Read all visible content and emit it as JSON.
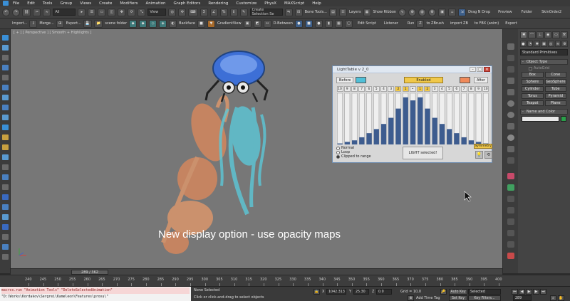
{
  "menu": [
    "File",
    "Edit",
    "Tools",
    "Group",
    "Views",
    "Create",
    "Modifiers",
    "Animation",
    "Graph Editors",
    "Rendering",
    "Customize",
    "PhysX",
    "MAXScript",
    "Help"
  ],
  "toolbar1": {
    "selection_filter": "All",
    "view_dropdown": "View",
    "create_selection_set": "Create Selection Se",
    "bone_tools": "Bone Tools...",
    "layers": "Layers",
    "show_ribbon": "Show Ribbon",
    "drag_n_drop": "Drag N Drop",
    "preview": "Preview",
    "folder": "Folder",
    "skinorder": "SkinOrder2"
  },
  "toolbar2": {
    "import": "Import...",
    "merge": "Merge...",
    "export": "Export",
    "scene_folder": "scene folder",
    "backface": "Backface",
    "gradient_view": "GradientView",
    "d_between": "D-Between",
    "edit_script": "Edit Script",
    "listener": "Listener",
    "run": "Run",
    "to_zbrush": "to ZBrush",
    "import_zb": "import ZB",
    "to_fbx": "to FBX (anim)",
    "export_extra": "Export..."
  },
  "viewport": {
    "label": "[ + ] [ Perspective ] [ Smooth + Highlights ]",
    "caption": "New display option - use opacity maps"
  },
  "lighttable": {
    "title": "LightTable v 2_0",
    "before_label": "Before",
    "after_label": "After",
    "enabled_label": "Enabled",
    "before_color": "#4fc0d8",
    "after_color": "#f08a5a",
    "numbers": [
      "10",
      "9",
      "8",
      "7",
      "6",
      "5",
      "4",
      "3",
      "2",
      "1",
      "•",
      "1",
      "2",
      "3",
      "4",
      "5",
      "6",
      "7",
      "8",
      "9",
      "10"
    ],
    "highlight_index": [
      8,
      9,
      11,
      12
    ],
    "bar_values": [
      0.02,
      0.05,
      0.08,
      0.14,
      0.22,
      0.3,
      0.4,
      0.52,
      0.7,
      0.92,
      0.86,
      0.92,
      0.7,
      0.52,
      0.4,
      0.3,
      0.22,
      0.14,
      0.08,
      0.05,
      0.02
    ],
    "options": [
      "Normal",
      "Loop",
      "Clipped to range"
    ],
    "selected_option": 2,
    "light_selected": "LIGHT selected!",
    "symmetry": "Symmetry",
    "fill_color": "#3d5c8f"
  },
  "cmdpanel": {
    "dropdown": "Standard Primitives",
    "object_type": "Object Type",
    "autogrid": "AutoGrid",
    "objects": [
      "Box",
      "Cone",
      "Sphere",
      "GeoSphere",
      "Cylinder",
      "Tube",
      "Torus",
      "Pyramid",
      "Teapot",
      "Plane"
    ],
    "name_and_color": "Name and Color",
    "name_color": "#2aa04a"
  },
  "timeline": {
    "frame_display": "289 / 362",
    "ticks": [
      "240",
      "245",
      "250",
      "255",
      "260",
      "265",
      "270",
      "275",
      "280",
      "285",
      "290",
      "295",
      "300",
      "305",
      "310",
      "315",
      "320",
      "325",
      "330",
      "335",
      "340",
      "345",
      "350",
      "355",
      "360",
      "365",
      "370",
      "375",
      "380",
      "385",
      "390",
      "395",
      "400"
    ]
  },
  "status": {
    "maxscript_line1": "macros.run \"Animation Tools\" \"DeleteSelectedAnimation\"",
    "maxscript_line2": "\"D:\\Works\\Kordakov\\Sergrei\\Kameleon\\Features\\proxu\\\"",
    "none_selected": "None Selected",
    "hint": "Click or click-and-drag to select objects",
    "x_value": "1042.313",
    "y_value": "25.30",
    "z_value": "0.0",
    "grid": "Grid = 10,0",
    "add_time_tag": "Add Time Tag",
    "auto_key": "Auto Key",
    "set_key": "Set Key",
    "selected": "Selected",
    "key_filters": "Key Filters...",
    "frame": "289"
  }
}
